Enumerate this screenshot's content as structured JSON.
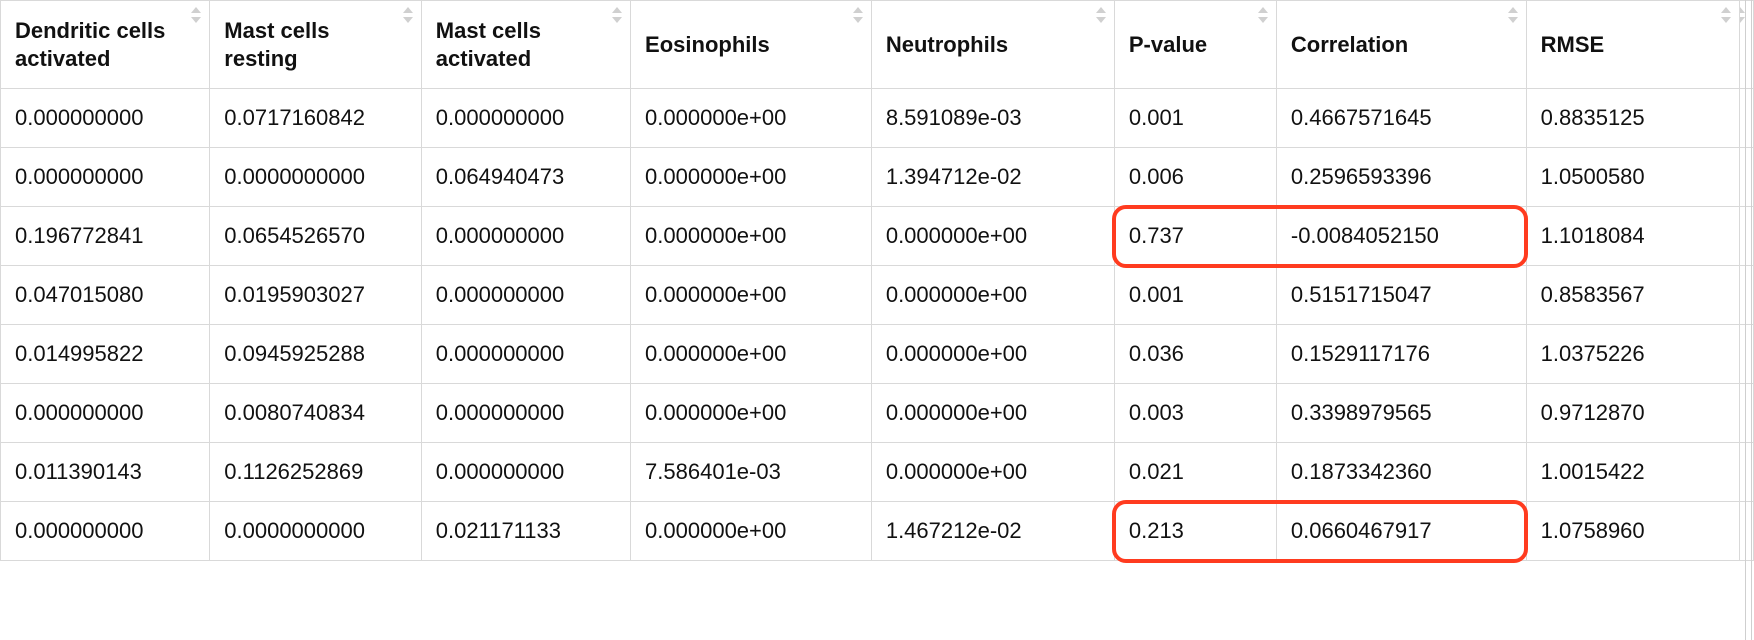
{
  "table": {
    "columns": [
      {
        "label": "Dendritic cells activated"
      },
      {
        "label": "Mast cells resting"
      },
      {
        "label": "Mast cells activated"
      },
      {
        "label": "Eosinophils"
      },
      {
        "label": "Neutrophils"
      },
      {
        "label": "P-value"
      },
      {
        "label": "Correlation"
      },
      {
        "label": "RMSE"
      }
    ],
    "rows": [
      [
        "0.000000000",
        "0.0717160842",
        "0.000000000",
        "0.000000e+00",
        "8.591089e-03",
        "0.001",
        "0.4667571645",
        "0.8835125"
      ],
      [
        "0.000000000",
        "0.0000000000",
        "0.064940473",
        "0.000000e+00",
        "1.394712e-02",
        "0.006",
        "0.2596593396",
        "1.0500580"
      ],
      [
        "0.196772841",
        "0.0654526570",
        "0.000000000",
        "0.000000e+00",
        "0.000000e+00",
        "0.737",
        "-0.0084052150",
        "1.1018084"
      ],
      [
        "0.047015080",
        "0.0195903027",
        "0.000000000",
        "0.000000e+00",
        "0.000000e+00",
        "0.001",
        "0.5151715047",
        "0.8583567"
      ],
      [
        "0.014995822",
        "0.0945925288",
        "0.000000000",
        "0.000000e+00",
        "0.000000e+00",
        "0.036",
        "0.1529117176",
        "1.0375226"
      ],
      [
        "0.000000000",
        "0.0080740834",
        "0.000000000",
        "0.000000e+00",
        "0.000000e+00",
        "0.003",
        "0.3398979565",
        "0.9712870"
      ],
      [
        "0.011390143",
        "0.1126252869",
        "0.000000000",
        "7.586401e-03",
        "0.000000e+00",
        "0.021",
        "0.1873342360",
        "1.0015422"
      ],
      [
        "0.000000000",
        "0.0000000000",
        "0.021171133",
        "0.000000e+00",
        "1.467212e-02",
        "0.213",
        "0.0660467917",
        "1.0758960"
      ]
    ]
  },
  "highlights": [
    {
      "row": 2,
      "col_start": 5,
      "col_end": 6
    },
    {
      "row": 7,
      "col_start": 5,
      "col_end": 6
    }
  ],
  "colors": {
    "highlight_border": "#ff3b1f"
  }
}
